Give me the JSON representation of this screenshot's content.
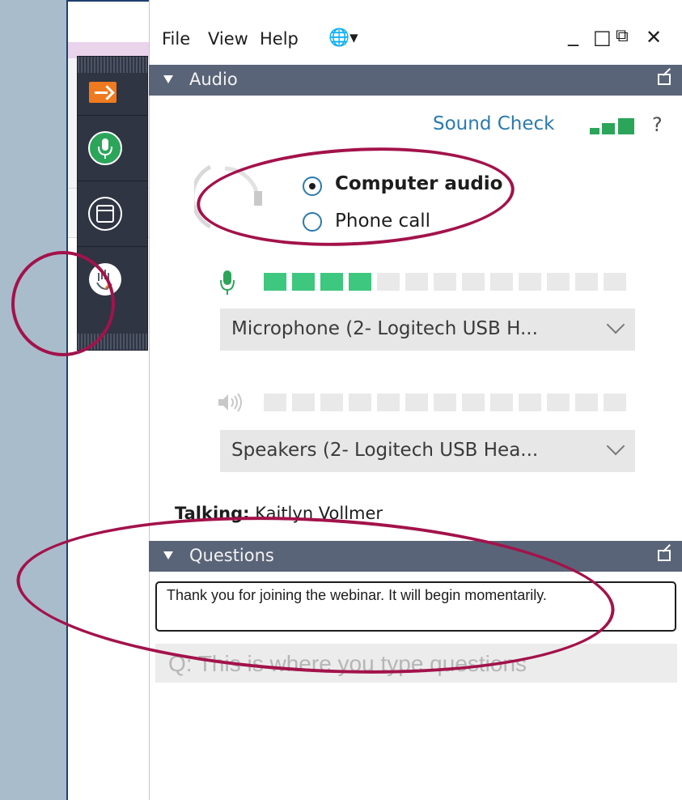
{
  "menu": {
    "file": "File",
    "view": "View",
    "help": "Help",
    "language": "🌐▾"
  },
  "window_controls": {
    "minimize": "_",
    "maximize": "□",
    "restore": "⧉",
    "close": "✕"
  },
  "audio": {
    "header": "Audio",
    "sound_check": "Sound Check",
    "help": "?",
    "computer_audio_label": "Computer audio",
    "phone_call_label": "Phone call",
    "selected_option": "Computer audio",
    "mic_level_active_segments": 4,
    "mic_level_total_segments": 13,
    "speaker_level_active_segments": 0,
    "speaker_level_total_segments": 13,
    "microphone_value": "Microphone (2- Logitech  USB H...",
    "speakers_value": "Speakers (2- Logitech  USB Hea..."
  },
  "talking": {
    "label": "Talking:",
    "name": "Kaitlyn Vollmer"
  },
  "questions": {
    "header": "Questions",
    "message": "Thank you for joining the webinar. It will begin momentarily.",
    "input_placeholder": "Q: This is where you type questions"
  },
  "colors": {
    "accent_green": "#2ba55a",
    "meter_green": "#3ec77e",
    "header_bg": "#5a6478",
    "link_blue": "#2a7ab0",
    "annotation": "#a3124b",
    "toolbar_bg": "#2f3542",
    "orange": "#f07a1f"
  },
  "toolbar_icons": [
    "arrow-right-icon",
    "microphone-icon",
    "window-icon",
    "raise-hand-icon"
  ]
}
